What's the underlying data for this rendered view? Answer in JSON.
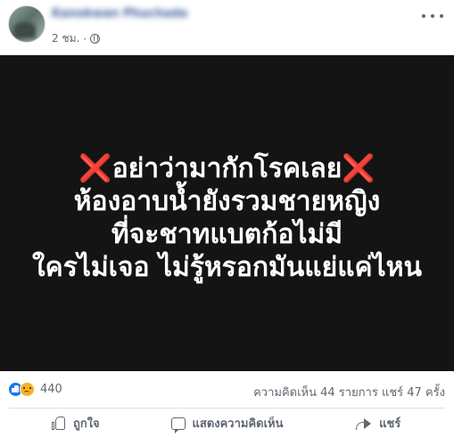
{
  "post": {
    "author": "Kanokwan Phuchada",
    "time": "2 ชม.",
    "privacy_icon": "globe-icon",
    "more_icon": "more-options-icon"
  },
  "image_text": {
    "line1_left_mark": "❌",
    "line1": "อย่าว่ามากักโรคเลย",
    "line1_right_mark": "❌",
    "line2": "ห้องอาบน้ำยังรวมชายหญิง",
    "line3": "ที่จะชาทแบตก้อไม่มี",
    "line4": "ใครไม่เจอ ไม่รู้หรอกมันแย่แค่ไหน"
  },
  "stats": {
    "reaction_icons": [
      "like-icon",
      "sad-icon"
    ],
    "reaction_count": "440",
    "comments_shares": "ความคิดเห็น 44 รายการ  แชร์ 47 ครั้ง"
  },
  "actions": {
    "like_label": "ถูกใจ",
    "comment_label": "แสดงความคิดเห็น",
    "share_label": "แชร์"
  },
  "colors": {
    "image_bg": "#141414",
    "cross_red": "#d43a2c",
    "link_blue": "#385898",
    "like_blue": "#1877f2",
    "sad_yellow": "#f7b125"
  }
}
